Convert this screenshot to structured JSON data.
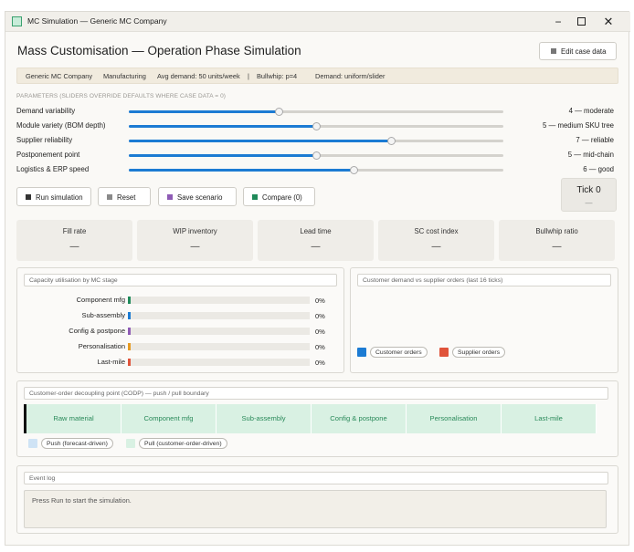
{
  "window": {
    "title": "MC Simulation — Generic MC Company",
    "controls": {
      "minimize": "−",
      "close": "✕"
    }
  },
  "header": {
    "title": "Mass Customisation — Operation Phase Simulation",
    "edit_button": "Edit case data"
  },
  "info_bar": {
    "company": "Generic MC Company",
    "sector": "Manufacturing",
    "avg_demand": "Avg demand: 50 units/week",
    "separator": "|",
    "bullwhip": "Bullwhip: p=4",
    "demand": "Demand: uniform/slider"
  },
  "parameters": {
    "caption": "PARAMETERS  (SLIDERS OVERRIDE DEFAULTS WHERE CASE DATA = 0)",
    "items": [
      {
        "label": "Demand variability",
        "value_text": "4 — moderate",
        "value": 4,
        "max": 10
      },
      {
        "label": "Module variety (BOM depth)",
        "value_text": "5 — medium SKU tree",
        "value": 5,
        "max": 10
      },
      {
        "label": "Supplier reliability",
        "value_text": "7 — reliable",
        "value": 7,
        "max": 10
      },
      {
        "label": "Postponement point",
        "value_text": "5 — mid-chain",
        "value": 5,
        "max": 10
      },
      {
        "label": "Logistics & ERP speed",
        "value_text": "6 — good",
        "value": 6,
        "max": 10
      }
    ]
  },
  "actions": {
    "run": "Run simulation",
    "reset": "Reset",
    "save": "Save scenario",
    "compare": "Compare  (0)",
    "colors": {
      "run": "#333333",
      "reset": "#8a8a8a",
      "save": "#8e5bb5",
      "compare": "#1f8a5a"
    }
  },
  "tick": {
    "label": "Tick 0",
    "sub": "—"
  },
  "kpis": [
    {
      "label": "Fill rate",
      "value": "—"
    },
    {
      "label": "WIP inventory",
      "value": "—"
    },
    {
      "label": "Lead time",
      "value": "—"
    },
    {
      "label": "SC cost index",
      "value": "—"
    },
    {
      "label": "Bullwhip ratio",
      "value": "—"
    }
  ],
  "capacity": {
    "caption": "Capacity utilisation by MC stage",
    "stages": [
      {
        "label": "Component mfg",
        "pct": "0%",
        "color": "#1f8a5a"
      },
      {
        "label": "Sub-assembly",
        "pct": "0%",
        "color": "#1c7bd3"
      },
      {
        "label": "Config & postpone",
        "pct": "0%",
        "color": "#8e5bb5"
      },
      {
        "label": "Personalisation",
        "pct": "0%",
        "color": "#e69b22"
      },
      {
        "label": "Last-mile",
        "pct": "0%",
        "color": "#e0533a"
      }
    ]
  },
  "demand_chart": {
    "caption": "Customer demand vs supplier orders (last 16 ticks)",
    "legend": [
      {
        "label": "Customer orders",
        "color": "#1c7bd3"
      },
      {
        "label": "Supplier orders",
        "color": "#e0533a"
      }
    ]
  },
  "codp": {
    "caption": "Customer-order decoupling point (CODP) — push / pull boundary",
    "stages": [
      "Raw material",
      "Component mfg",
      "Sub-assembly",
      "Config & postpone",
      "Personalisation",
      "Last-mile"
    ],
    "legend": [
      {
        "label": "Push (forecast-driven)",
        "color": "#cfe3f5"
      },
      {
        "label": "Pull (customer-order-driven)",
        "color": "#d9f1e3"
      }
    ]
  },
  "event_log": {
    "caption": "Event log",
    "text": "Press Run to start the simulation."
  }
}
